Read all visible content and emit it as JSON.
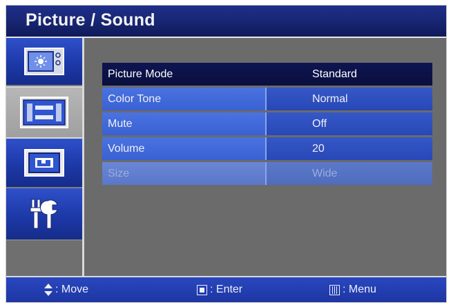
{
  "osd": {
    "title": "Picture / Sound",
    "sidebar": {
      "items": [
        {
          "icon": "picture-icon",
          "selected": false
        },
        {
          "icon": "sound-icon",
          "selected": true
        },
        {
          "icon": "screen-size-icon",
          "selected": false
        },
        {
          "icon": "setup-tools-icon",
          "selected": false
        }
      ]
    },
    "menu": {
      "rows": [
        {
          "label": "Picture Mode",
          "value": "Standard",
          "state": "active"
        },
        {
          "label": "Color Tone",
          "value": "Normal",
          "state": "normal"
        },
        {
          "label": "Mute",
          "value": "Off",
          "state": "normal"
        },
        {
          "label": "Volume",
          "value": "20",
          "state": "normal"
        },
        {
          "label": "Size",
          "value": "Wide",
          "state": "disabled"
        }
      ]
    },
    "statusbar": {
      "move_label": ": Move",
      "enter_label": ": Enter",
      "menu_label": ": Menu"
    },
    "colors": {
      "title_bar": "#16246e",
      "active_row": "#0e1551",
      "row_blue": "#3961d3",
      "status_bar": "#2a47c0",
      "background_gray": "#6b6b6b"
    }
  }
}
